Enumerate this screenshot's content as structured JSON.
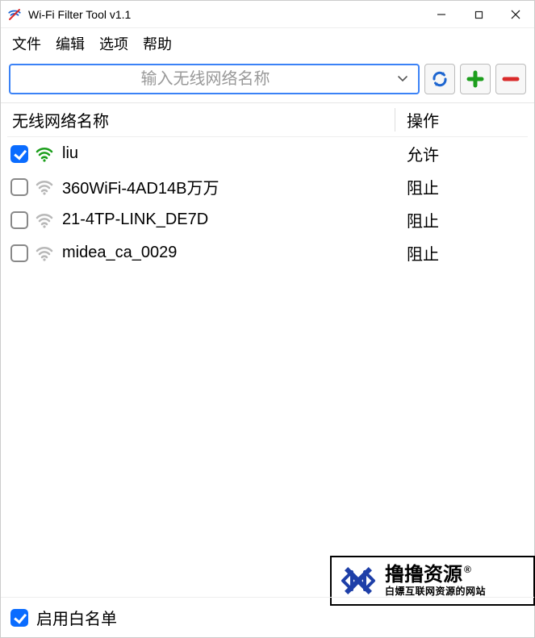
{
  "window": {
    "title": "Wi-Fi Filter Tool v1.1"
  },
  "menu": {
    "file": "文件",
    "edit": "编辑",
    "options": "选项",
    "help": "帮助"
  },
  "toolbar": {
    "placeholder": "输入无线网络名称"
  },
  "columns": {
    "name": "无线网络名称",
    "action": "操作"
  },
  "networks": [
    {
      "checked": true,
      "name": "liu",
      "status": "允许",
      "active": true
    },
    {
      "checked": false,
      "name": "360WiFi-4AD14B万万",
      "status": "阻止",
      "active": false
    },
    {
      "checked": false,
      "name": "21-4TP-LINK_DE7D",
      "status": "阻止",
      "active": false
    },
    {
      "checked": false,
      "name": "midea_ca_0029",
      "status": "阻止",
      "active": false
    }
  ],
  "footer": {
    "whitelist_checked": true,
    "whitelist_label": "启用白名单"
  },
  "watermark": {
    "line1": "撸撸资源",
    "reg": "®",
    "line2": "白嫖互联网资源的网站"
  }
}
